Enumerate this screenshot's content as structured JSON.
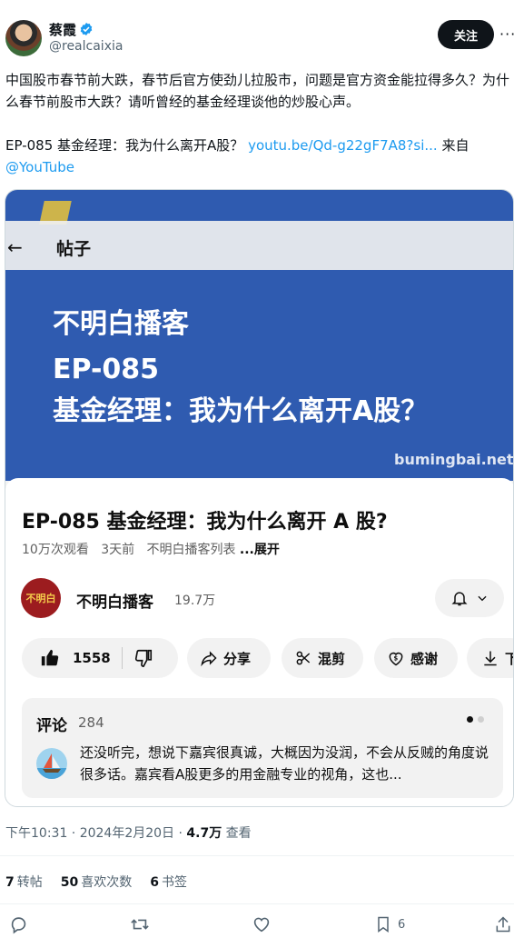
{
  "author": {
    "name": "蔡霞",
    "handle": "@realcaixia",
    "follow_label": "关注",
    "more_label": "···",
    "verified_color": "#1d9bf0"
  },
  "tweet": {
    "text": "中国股市春节前大跌，春节后官方使劲儿拉股市，问题是官方资金能拉得多久？为什么春节前股市大跌？请听曾经的基金经理谈他的炒股心声。",
    "line2_prefix": "EP-085 基金经理：我为什么离开A股？",
    "link_text": "youtu.be/Qd-g22gF7A8?si...",
    "line2_suffix": "来自",
    "mention": "@YouTube"
  },
  "embedded": {
    "post_bar_title": "帖子",
    "video": {
      "line1": "不明白播客",
      "line2": "EP-085",
      "line3": "基金经理：我为什么离开A股？",
      "watermark": "bumingbai.net"
    },
    "youtube": {
      "title": "EP-085 基金经理：我为什么离开 A 股?",
      "views": "10万次观看",
      "age": "3天前",
      "playlist": "不明白播客列表",
      "expand": "...展开",
      "channel_logo": "不明白",
      "channel_name": "不明白播客",
      "subscribers": "19.7万",
      "likes": "1558",
      "share": "分享",
      "remix": "混剪",
      "thanks": "感谢",
      "download": "下",
      "comments_label": "评论",
      "comments_count": "284",
      "top_comment": "还没听完，想说下嘉宾很真诚，大概因为没润，不会从反贼的角度说很多话。嘉宾看A股更多的用金融专业的视角，这也..."
    }
  },
  "footer": {
    "time": "下午10:31 · 2024年2月20日 · ",
    "views": "4.7万",
    "views_label": " 查看",
    "retweets": "7",
    "retweets_label": "转帖",
    "likes": "50",
    "likes_label": "喜欢次数",
    "bookmarks": "6",
    "bookmarks_label": "书签",
    "bookmark_count": "6"
  },
  "icons": [
    "verified-icon",
    "back-arrow-icon",
    "bell-icon",
    "chevron-down-icon",
    "thumbs-up-icon",
    "thumbs-down-icon",
    "share-icon",
    "remix-icon",
    "thanks-icon",
    "download-icon",
    "reply-icon",
    "retweet-icon",
    "like-icon",
    "bookmark-icon",
    "upload-icon"
  ],
  "colors": {
    "video_bg": "#2f5bb0",
    "link": "#1d9bf0",
    "text": "#0f1419",
    "muted": "#536471"
  }
}
